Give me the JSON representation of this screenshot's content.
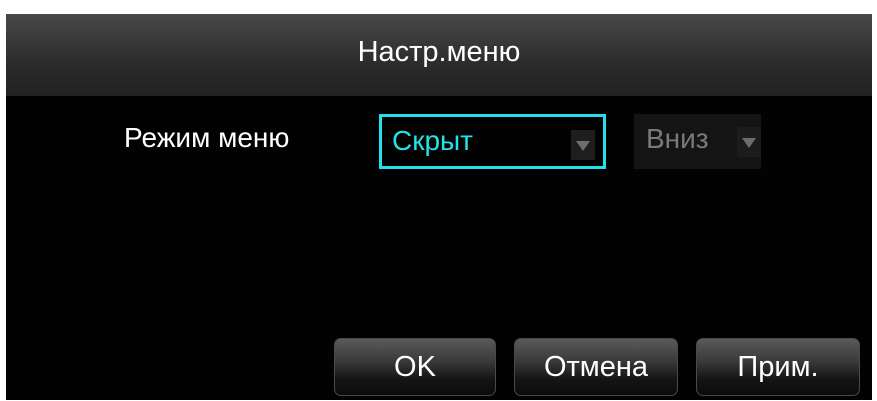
{
  "dialog": {
    "title": "Настр.меню"
  },
  "settings": {
    "menu_mode_label": "Режим меню",
    "menu_mode_value": "Скрыт",
    "position_value": "Вниз"
  },
  "buttons": {
    "ok": "OK",
    "cancel": "Отмена",
    "apply": "Прим."
  },
  "colors": {
    "focus_accent": "#22e2e8",
    "background": "#020202",
    "disabled_text": "#7a7a7a"
  },
  "icons": {
    "dropdown": "chevron-down-icon"
  }
}
